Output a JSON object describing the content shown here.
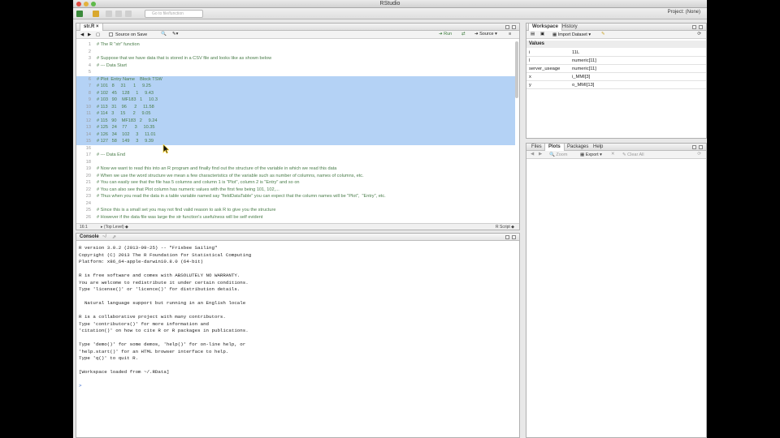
{
  "window": {
    "title": "RStudio",
    "project": "Project: (None)",
    "goto_placeholder": "Go to file/function"
  },
  "editor": {
    "tab": "str.R",
    "source_on_save": "Source on Save",
    "run": "Run",
    "source": "Source",
    "status_pos": "16:1",
    "status_scope": "(Top Level)",
    "status_type": "R Script",
    "lines": [
      {
        "n": "1",
        "t": "# The R \"str\" function",
        "sel": false
      },
      {
        "n": "2",
        "t": "",
        "sel": false
      },
      {
        "n": "3",
        "t": "# Suppose that we have data that is stored in a CSV file and looks like as shown below",
        "sel": false
      },
      {
        "n": "4",
        "t": "# --- Data Start",
        "sel": false
      },
      {
        "n": "5",
        "t": "",
        "sel": false
      },
      {
        "n": "6",
        "t": "# Plot  Entry Name    Block TSW",
        "sel": true
      },
      {
        "n": "7",
        "t": "# 101   8     31      1     9.25",
        "sel": true
      },
      {
        "n": "8",
        "t": "# 102   45    128     1     9.43",
        "sel": true
      },
      {
        "n": "9",
        "t": "# 103   90    MF183   1     10.3",
        "sel": true
      },
      {
        "n": "10",
        "t": "# 113   31    96      2     11.58",
        "sel": true
      },
      {
        "n": "11",
        "t": "# 114   3     15      2     9.05",
        "sel": true
      },
      {
        "n": "12",
        "t": "# 115   90    MF183   2     9.24",
        "sel": true
      },
      {
        "n": "13",
        "t": "# 125   24    77      3     10.35",
        "sel": true
      },
      {
        "n": "14",
        "t": "# 126   34    102     3     11.01",
        "sel": true
      },
      {
        "n": "15",
        "t": "# 127   58    149     3     9.39",
        "sel": true
      },
      {
        "n": "16",
        "t": "",
        "sel": false
      },
      {
        "n": "17",
        "t": "# --- Data End",
        "sel": false
      },
      {
        "n": "18",
        "t": "",
        "sel": false
      },
      {
        "n": "19",
        "t": "# Now we want to read this into an R program and finally find out the structure of the variable in which we read this data",
        "sel": false
      },
      {
        "n": "20",
        "t": "# When we use the word structure we mean a few characteristics of the variable such as number of columns, names of columns, etc.",
        "sel": false
      },
      {
        "n": "21",
        "t": "# You can easily see that the file has 5 columns and column 1 is \"Plot\", column 2 is \"Entry\" and so on",
        "sel": false
      },
      {
        "n": "22",
        "t": "# You can also see that Plot column has numeric values with the first few being 101, 102,...",
        "sel": false
      },
      {
        "n": "23",
        "t": "# Thus when you read the data in a table variable named say \"fieldDataTable\" you can expect that the column names will be \"Plot\",  \"Entry\", etc.",
        "sel": false
      },
      {
        "n": "24",
        "t": "",
        "sel": false
      },
      {
        "n": "25",
        "t": "# Since this is a small set you may not find valid reason to ask R to give you the structure",
        "sel": false
      },
      {
        "n": "26",
        "t": "# However if the data file was large the str function's usefulness will be self evident",
        "sel": false
      }
    ]
  },
  "console": {
    "title": "Console",
    "path": "~/",
    "lines": [
      "R version 3.0.2 (2013-09-25) -- \"Frisbee Sailing\"",
      "Copyright (C) 2013 The R Foundation for Statistical Computing",
      "Platform: x86_64-apple-darwin10.8.0 (64-bit)",
      "",
      "R is free software and comes with ABSOLUTELY NO WARRANTY.",
      "You are welcome to redistribute it under certain conditions.",
      "Type 'license()' or 'licence()' for distribution details.",
      "",
      "  Natural language support but running in an English locale",
      "",
      "R is a collaborative project with many contributors.",
      "Type 'contributors()' for more information and",
      "'citation()' on how to cite R or R packages in publications.",
      "",
      "Type 'demo()' for some demos, 'help()' for on-line help, or",
      "'help.start()' for an HTML browser interface to help.",
      "Type 'q()' to quit R.",
      "",
      "[Workspace loaded from ~/.RData]",
      ""
    ],
    "prompt": ">"
  },
  "workspace": {
    "tabs": [
      "Workspace",
      "History"
    ],
    "import": "Import Dataset",
    "section": "Values",
    "rows": [
      {
        "name": "i",
        "value": "11L"
      },
      {
        "name": "l",
        "value": "numeric[11]"
      },
      {
        "name": "server_useage",
        "value": "numeric[11]"
      },
      {
        "name": "x",
        "value": "i_MMI[3]"
      },
      {
        "name": "y",
        "value": "o_MMI[13]"
      }
    ]
  },
  "files": {
    "tabs": [
      "Files",
      "Plots",
      "Packages",
      "Help"
    ],
    "zoom": "Zoom",
    "export": "Export",
    "clear": "Clear All"
  }
}
